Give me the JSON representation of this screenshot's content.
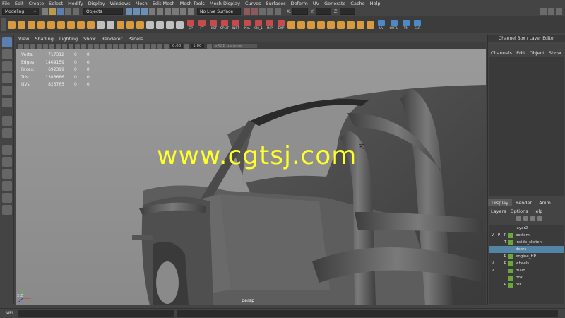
{
  "menubar": [
    "File",
    "Edit",
    "Create",
    "Select",
    "Modify",
    "Display",
    "Windows",
    "Mesh",
    "Edit Mesh",
    "Mesh Tools",
    "Mesh Display",
    "Curves",
    "Surfaces",
    "Deform",
    "UV",
    "Generate",
    "Cache",
    "Help"
  ],
  "status": {
    "mode": "Modeling",
    "selection_mode": "Objects",
    "live_surface": "No Live Surface",
    "x_label": "X:",
    "y_label": "Y:",
    "z_label": "Z:"
  },
  "shelf": {
    "labels": [
      "CP",
      "FT",
      "HIST",
      "SPLIT",
      "INST",
      "Nm",
      "SM_1",
      "IMP",
      "EXP",
      "UV",
      "OUTL",
      "TM",
      "CLR"
    ]
  },
  "panel_menu": [
    "View",
    "Shading",
    "Lighting",
    "Show",
    "Renderer",
    "Panels"
  ],
  "panel_toolbar": {
    "gamma_value_1": "0.00",
    "gamma_value_2": "1.00",
    "color_space": "sRGB gamma"
  },
  "hud": [
    {
      "label": "Verts:",
      "v1": "717312",
      "v2": "0",
      "v3": "0"
    },
    {
      "label": "Edges:",
      "v1": "1409159",
      "v2": "0",
      "v3": "0"
    },
    {
      "label": "Faces:",
      "v1": "692399",
      "v2": "0",
      "v3": "0"
    },
    {
      "label": "Tris:",
      "v1": "1383686",
      "v2": "0",
      "v3": "0"
    },
    {
      "label": "UVs:",
      "v1": "825765",
      "v2": "0",
      "v3": "0"
    }
  ],
  "watermark": "www.cgtsj.com",
  "camera_label": "persp",
  "axis_label": "X Z",
  "channel_box": {
    "title": "Channel Box / Layer Editor",
    "menu": [
      "Channels",
      "Edit",
      "Object",
      "Show"
    ]
  },
  "layer_editor": {
    "tabs": [
      "Display",
      "Render",
      "Anim"
    ],
    "menu": [
      "Layers",
      "Options",
      "Help"
    ],
    "layers": [
      {
        "v": "",
        "p": "",
        "r": "",
        "name": "layer2",
        "swatch": false,
        "selected": false
      },
      {
        "v": "V",
        "p": "P",
        "r": "R",
        "name": "bottom",
        "swatch": true,
        "selected": false
      },
      {
        "v": "",
        "p": "",
        "r": "T",
        "name": "inside_sketch",
        "swatch": true,
        "selected": false
      },
      {
        "v": "",
        "p": "",
        "r": "",
        "name": "doors",
        "swatch": false,
        "selected": true
      },
      {
        "v": "",
        "p": "",
        "r": "R",
        "name": "engine_HP",
        "swatch": true,
        "selected": false
      },
      {
        "v": "V",
        "p": "",
        "r": "R",
        "name": "wheels",
        "swatch": true,
        "selected": false
      },
      {
        "v": "V",
        "p": "",
        "r": "",
        "name": "main",
        "swatch": true,
        "selected": false
      },
      {
        "v": "",
        "p": "",
        "r": "",
        "name": "box",
        "swatch": true,
        "selected": false
      },
      {
        "v": "",
        "p": "",
        "r": "R",
        "name": "ref",
        "swatch": true,
        "selected": false
      }
    ]
  },
  "command_line": {
    "label": "MEL"
  },
  "colors": {
    "accent": "#5285a6",
    "layer_green": "#6aa73c",
    "watermark": "#ffff2a",
    "shelf_orange": "#e0882c"
  }
}
